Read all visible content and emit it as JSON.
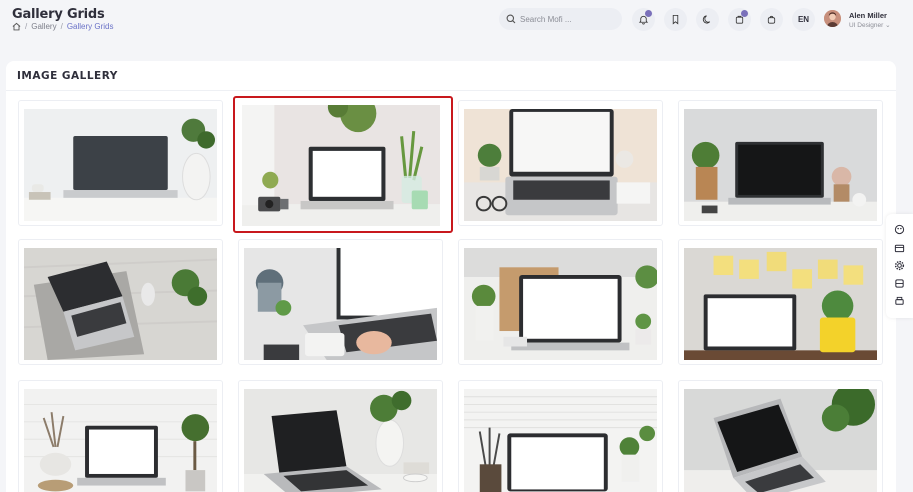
{
  "header": {
    "title": "Gallery Grids",
    "breadcrumb": [
      "Gallery",
      "Gallery Grids"
    ],
    "search_placeholder": "Search Mofi ...",
    "language": "EN",
    "user_name": "Alen Miller",
    "user_role": "UI Designer"
  },
  "card": {
    "title": "IMAGE GALLERY"
  },
  "gallery": [
    {
      "alt": "laptop-on-desk-with-plant"
    },
    {
      "alt": "laptop-with-camera-and-plants"
    },
    {
      "alt": "laptop-top-view-with-coffee"
    },
    {
      "alt": "laptop-dark-screen-with-plant"
    },
    {
      "alt": "laptop-top-view-on-mat"
    },
    {
      "alt": "hands-typing-on-laptop"
    },
    {
      "alt": "laptop-on-wooden-desk"
    },
    {
      "alt": "laptop-with-sticky-notes"
    },
    {
      "alt": "laptop-with-bricks-wall"
    },
    {
      "alt": "laptop-black-screen-vase"
    },
    {
      "alt": "laptop-with-window-blinds"
    },
    {
      "alt": "laptop-angled-with-plant"
    }
  ],
  "colors": {
    "accent": "#7a70ba",
    "selected_border": "#c8181d"
  }
}
